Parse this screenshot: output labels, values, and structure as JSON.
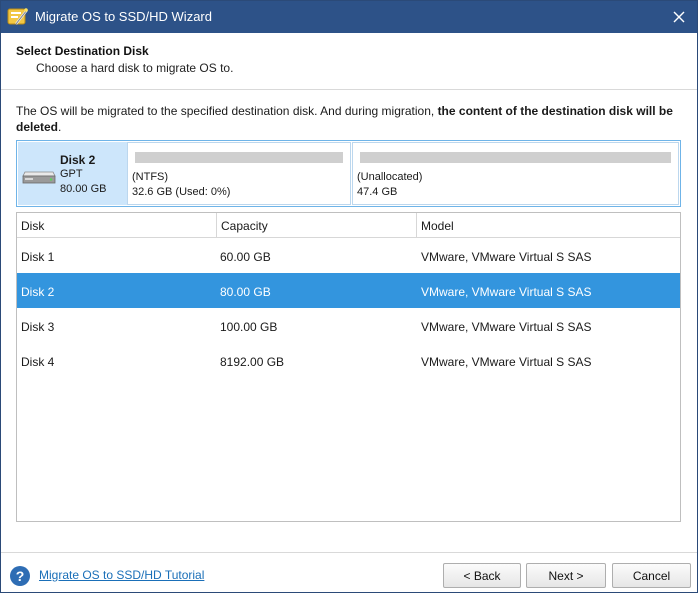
{
  "window": {
    "title": "Migrate OS to SSD/HD Wizard",
    "app_icon": "wizard-wand-icon",
    "close_icon": "close-icon"
  },
  "header": {
    "title": "Select Destination Disk",
    "subtitle": "Choose a hard disk to migrate OS to."
  },
  "notice": {
    "text": "The OS will be migrated to the specified destination disk. And during migration, ",
    "bold_text": "the content of the destination disk will be deleted",
    "end": "."
  },
  "disk_map": {
    "name": "Disk 2",
    "scheme": "GPT",
    "size": "80.00 GB",
    "partitions": [
      {
        "fs": "(NTFS)",
        "info": "32.6 GB (Used: 0%)"
      },
      {
        "fs": "(Unallocated)",
        "info": "47.4 GB"
      }
    ]
  },
  "table": {
    "headers": [
      "Disk",
      "Capacity",
      "Model"
    ],
    "rows": [
      {
        "disk": "Disk 1",
        "capacity": "60.00 GB",
        "model": "VMware, VMware Virtual S SAS",
        "selected": false
      },
      {
        "disk": "Disk 2",
        "capacity": "80.00 GB",
        "model": "VMware, VMware Virtual S SAS",
        "selected": true
      },
      {
        "disk": "Disk 3",
        "capacity": "100.00 GB",
        "model": "VMware, VMware Virtual S SAS",
        "selected": false
      },
      {
        "disk": "Disk 4",
        "capacity": "8192.00 GB",
        "model": "VMware, VMware Virtual S SAS",
        "selected": false
      }
    ]
  },
  "footer": {
    "help_icon": "help-icon",
    "tutorial_link": "Migrate OS to SSD/HD Tutorial",
    "back_label": "< Back",
    "next_label": "Next >",
    "cancel_label": "Cancel"
  },
  "colors": {
    "titlebar": "#2d5288",
    "selection": "#3395de",
    "disk_info_bg": "#cde6fb",
    "link": "#1a6fb8"
  }
}
